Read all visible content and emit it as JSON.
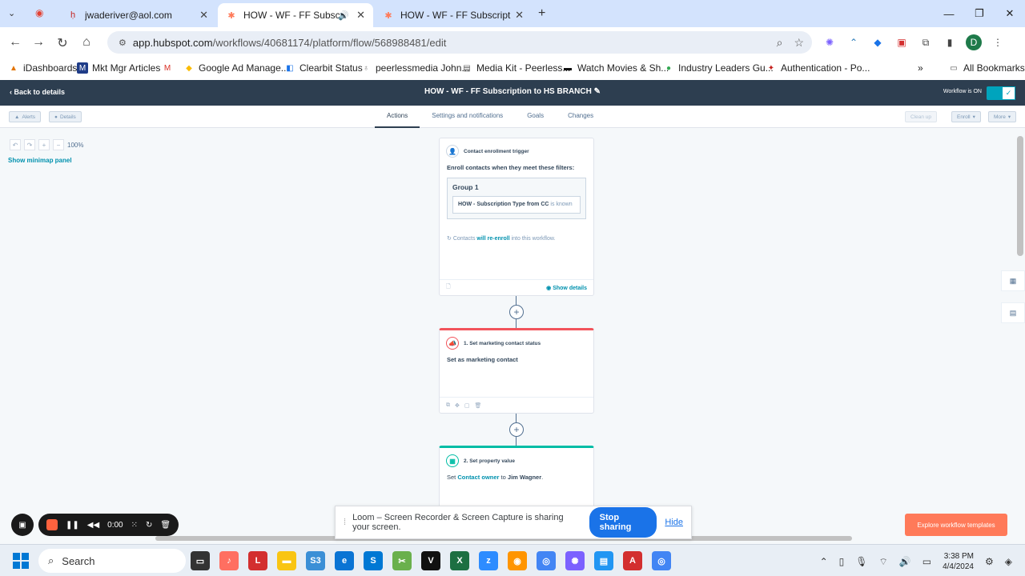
{
  "browser": {
    "tabs": [
      {
        "title": "jwaderiver@aol.com",
        "active": false
      },
      {
        "title": "HOW - WF - FF Subscription",
        "active": true
      },
      {
        "title": "HOW - WF - FF Subscription to",
        "active": false
      }
    ],
    "url_host": "app.hubspot.com",
    "url_path": "/workflows/40681174/platform/flow/568988481/edit",
    "profile_initial": "D",
    "bookmarks": [
      "iDashboards",
      "Mkt Mgr Articles",
      "Google Ad Manage...",
      "Clearbit Status",
      "peerlessmedia John...",
      "Media Kit - Peerless...",
      "Watch Movies & Sh...",
      "Industry Leaders Gu...",
      "Authentication - Po..."
    ],
    "all_bookmarks": "All Bookmarks"
  },
  "header": {
    "back_label": "Back to details",
    "workflow_title": "HOW - WF - FF Subscription to HS BRANCH",
    "status_label": "Workflow is ON"
  },
  "subbar": {
    "alerts": "Alerts",
    "details": "Details",
    "tabs": [
      "Actions",
      "Settings and notifications",
      "Goals",
      "Changes"
    ],
    "cleanup": "Clean up",
    "enroll": "Enroll",
    "more": "More"
  },
  "canvas": {
    "zoom": "100%",
    "minimap_label": "Show minimap panel",
    "trigger": {
      "title": "Contact enrollment trigger",
      "subtitle": "Enroll contacts when they meet these filters:",
      "group_label": "Group 1",
      "filter_prop": "HOW - Subscription Type from CC",
      "filter_op": "is known",
      "reenroll_pre": "Contacts",
      "reenroll_link": "will re-enroll",
      "reenroll_post": "into this workflow.",
      "show_details": "Show details"
    },
    "action1": {
      "title": "1. Set marketing contact status",
      "body": "Set as marketing contact"
    },
    "action2": {
      "title": "2. Set property value",
      "body_pre": "Set",
      "body_prop": "Contact owner",
      "body_mid": "to",
      "body_value": "Jim Wagner",
      "body_end": "."
    },
    "explore_label": "Explore workflow templates"
  },
  "loom": {
    "timer": "0:00",
    "share_text": "Loom – Screen Recorder & Screen Capture is sharing your screen.",
    "stop_label": "Stop sharing",
    "hide_label": "Hide"
  },
  "taskbar": {
    "search_placeholder": "Search",
    "time": "3:38 PM",
    "date": "4/4/2024"
  },
  "colors": {
    "hs_header": "#2d3e50",
    "accent_teal": "#00a4bd",
    "orange_bar": "#f2545b",
    "green_bar": "#00bda5",
    "explore_btn": "#ff7a59"
  }
}
